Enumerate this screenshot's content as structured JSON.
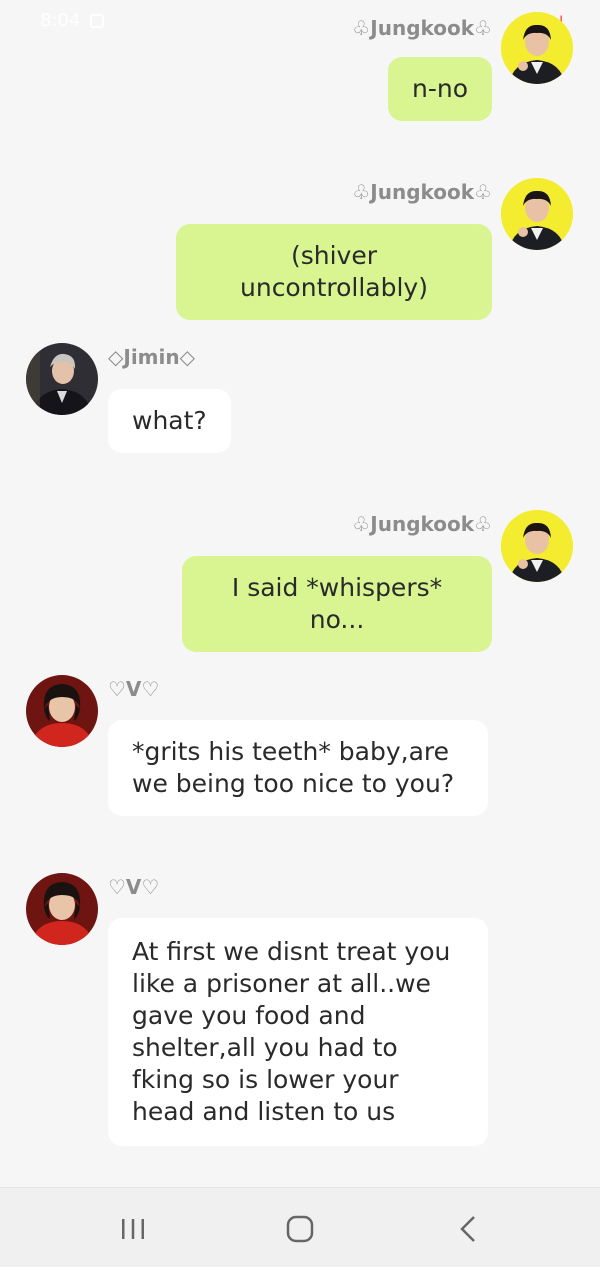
{
  "status_bar": {
    "time": "8:04",
    "battery": "%"
  },
  "messages": [
    {
      "sender": "♧Jungkook♧",
      "text": "n-no",
      "side": "right",
      "avatar": "jungkook-avatar"
    },
    {
      "sender": "♧Jungkook♧",
      "text": "(shiver uncontrollably)",
      "side": "right",
      "avatar": "jungkook-avatar"
    },
    {
      "sender": "◇Jimin◇",
      "text": "what?",
      "side": "left",
      "avatar": "jimin-avatar"
    },
    {
      "sender": "♧Jungkook♧",
      "text": "I said *whispers* no...",
      "side": "right",
      "avatar": "jungkook-avatar"
    },
    {
      "sender": "♡V♡",
      "text": "*grits his teeth* baby,are we being too nice to you?",
      "side": "left",
      "avatar": "v-avatar"
    },
    {
      "sender": "♡V♡",
      "text": "At first we disnt treat you like a prisoner at all..we gave you food and shelter,all you had to fking so is lower your head and listen to us",
      "side": "left",
      "avatar": "v-avatar"
    }
  ],
  "colors": {
    "background": "#f6f6f6",
    "sent_bubble": "#d8f592",
    "received_bubble": "#ffffff",
    "jungkook_avatar_bg": "#f4ec2f",
    "v_avatar_bg": "#c42a24",
    "name_text": "#8c8c8c"
  },
  "nav_bar": {
    "recent": "recent-apps-icon",
    "home": "home-icon",
    "back": "back-icon"
  }
}
